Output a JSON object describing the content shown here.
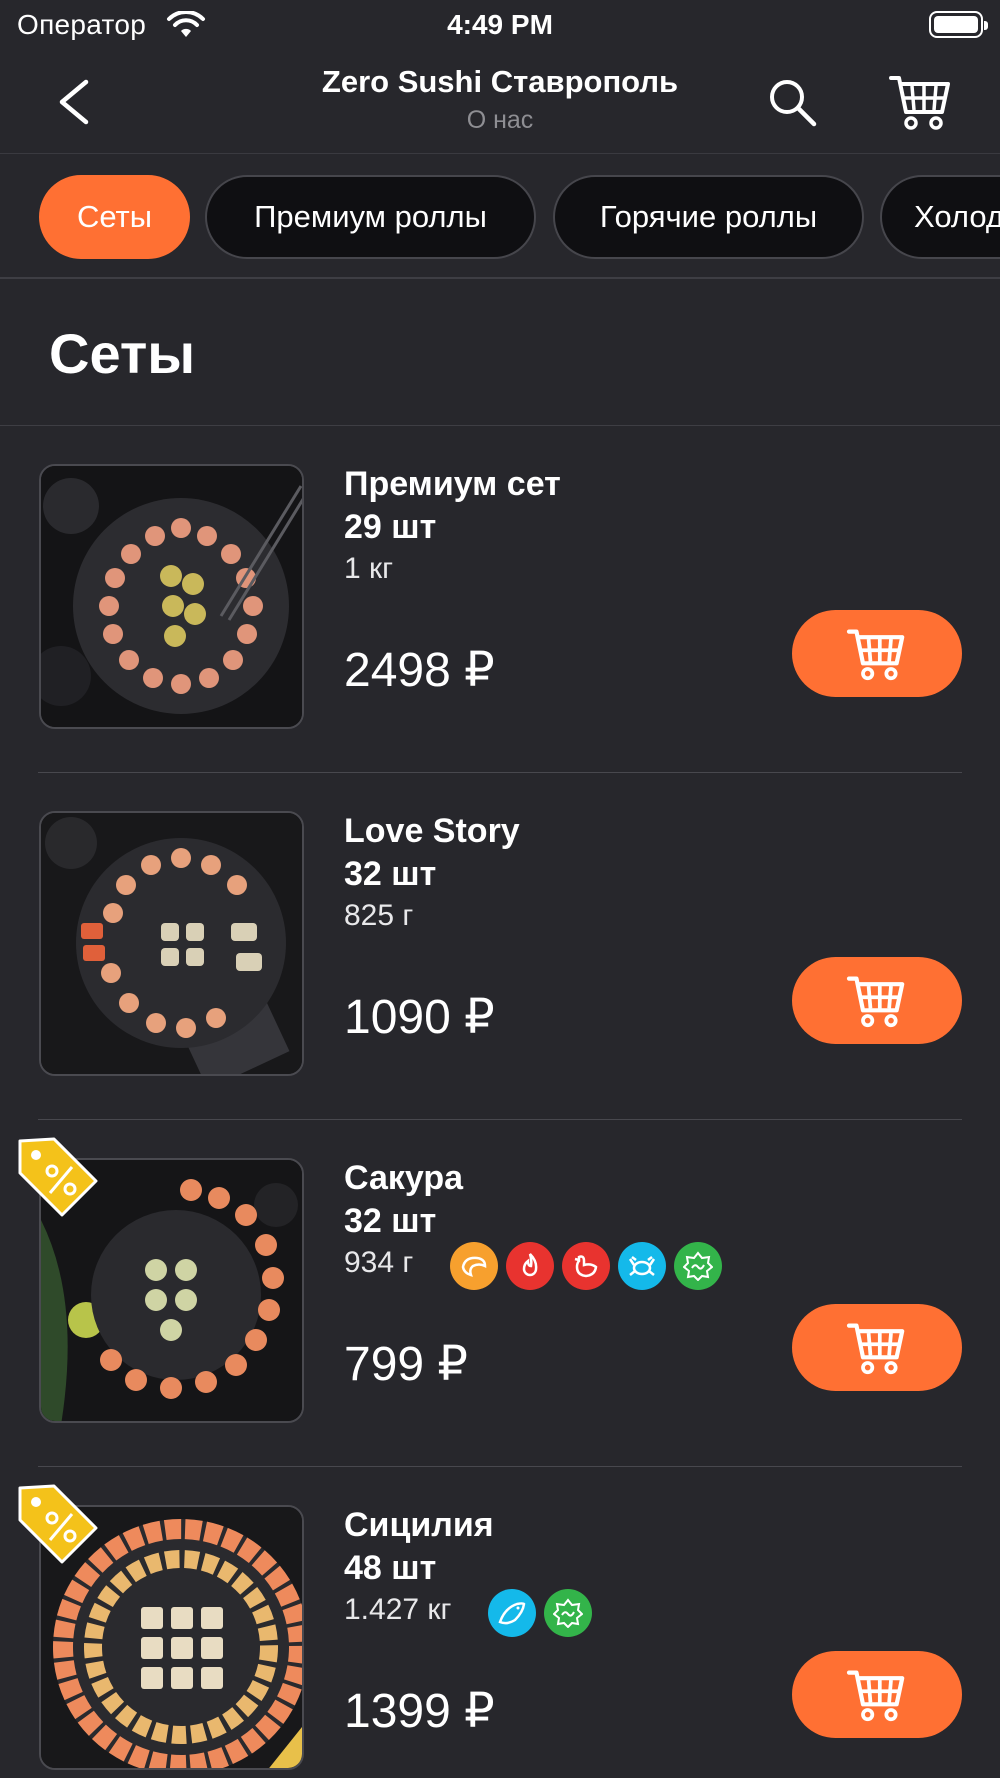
{
  "status_bar": {
    "carrier": "Оператор",
    "time": "4:49 PM"
  },
  "nav": {
    "title": "Zero Sushi Ставрополь",
    "subtitle": "О нас"
  },
  "categories": [
    {
      "label": "Сеты",
      "active": true
    },
    {
      "label": "Премиум роллы",
      "active": false
    },
    {
      "label": "Горячие роллы",
      "active": false
    },
    {
      "label": "Холодные роллы",
      "active": false
    }
  ],
  "section_title": "Сеты",
  "products": [
    {
      "name_line1": "Премиум сет",
      "name_line2": "29 шт",
      "weight": "1 кг",
      "price": "2498 ₽",
      "discount": false,
      "badges": []
    },
    {
      "name_line1": "Love Story",
      "name_line2": "32 шт",
      "weight": "825 г",
      "price": "1090 ₽",
      "discount": false,
      "badges": []
    },
    {
      "name_line1": "Сакура",
      "name_line2": "32 шт",
      "weight": "934 г",
      "price": "799 ₽",
      "discount": true,
      "badges": [
        {
          "icon": "shrimp-icon",
          "color": "#f7a02e"
        },
        {
          "icon": "spicy-fire-icon",
          "color": "#e8332f"
        },
        {
          "icon": "chicken-icon",
          "color": "#e8332f"
        },
        {
          "icon": "crab-icon",
          "color": "#14b9ea"
        },
        {
          "icon": "halal-icon",
          "color": "#33b44a"
        }
      ]
    },
    {
      "name_line1": "Сицилия",
      "name_line2": "48 шт",
      "weight": "1.427 кг",
      "price": "1399 ₽",
      "discount": true,
      "badges": [
        {
          "icon": "fish-icon",
          "color": "#14b9ea"
        },
        {
          "icon": "halal-icon",
          "color": "#33b44a"
        }
      ]
    }
  ],
  "colors": {
    "accent": "#ff7033",
    "background": "#27272c",
    "tab_background": "#0f0f12",
    "discount_tag": "#f4c21a"
  }
}
